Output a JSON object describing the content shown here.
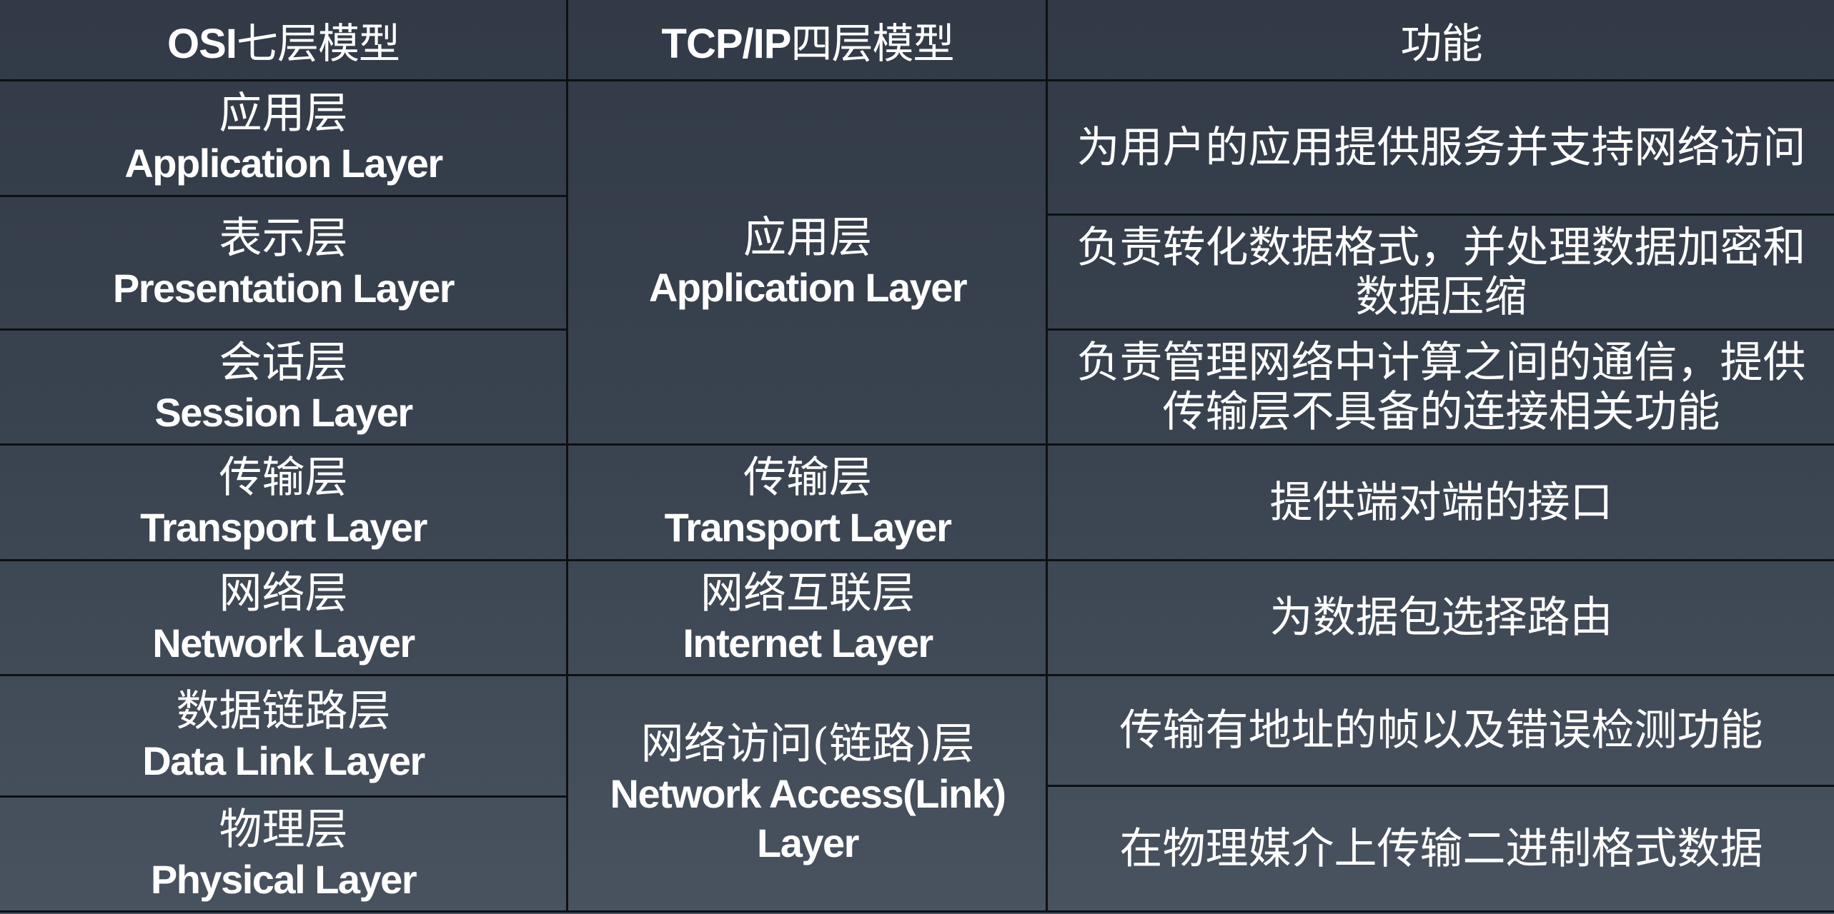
{
  "header": {
    "osi": {
      "latin": "OSI",
      "zh": "七层模型"
    },
    "tcpip": {
      "latin": "TCP/IP",
      "zh": "四层模型"
    },
    "function": "功能"
  },
  "osi_layers": [
    {
      "zh": "应用层",
      "en": "Application Layer"
    },
    {
      "zh": "表示层",
      "en": "Presentation Layer"
    },
    {
      "zh": "会话层",
      "en": "Session Layer"
    },
    {
      "zh": "传输层",
      "en": "Transport Layer"
    },
    {
      "zh": "网络层",
      "en": "Network Layer"
    },
    {
      "zh": "数据链路层",
      "en": "Data Link Layer"
    },
    {
      "zh": "物理层",
      "en": "Physical Layer"
    }
  ],
  "tcpip_layers": [
    {
      "zh": "应用层",
      "en": "Application Layer",
      "en2": ""
    },
    {
      "zh": "传输层",
      "en": "Transport Layer",
      "en2": ""
    },
    {
      "zh": "网络互联层",
      "en": "Internet Layer",
      "en2": ""
    },
    {
      "zh": "网络访问(链路)层",
      "en": "Network Access(Link)",
      "en2": "Layer"
    }
  ],
  "functions": [
    "为用户的应用提供服务并支持网络访问",
    "负责转化数据格式，并处理数据加密和数据压缩",
    "负责管理网络中计算之间的通信，提供传输层不具备的连接相关功能",
    "提供端对端的接口",
    "为数据包选择路由",
    "传输有地址的帧以及错误检测功能",
    "在物理媒介上传输二进制格式数据"
  ]
}
